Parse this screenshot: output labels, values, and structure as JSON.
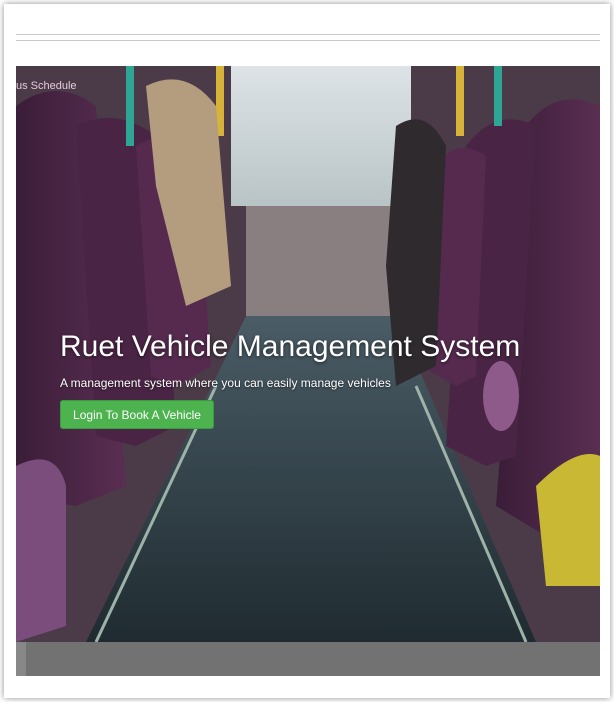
{
  "nav": {
    "visible_item_label": "us Schedule"
  },
  "hero": {
    "title": "Ruet Vehicle Management System",
    "subtitle": "A management system where you can easily manage vehicles",
    "cta_label": "Login To Book A Vehicle",
    "background_image": "bus-interior-photo"
  },
  "colors": {
    "cta_background": "#4db34f",
    "nav_text": "#e6c9de",
    "footer_bar": "#727272"
  }
}
